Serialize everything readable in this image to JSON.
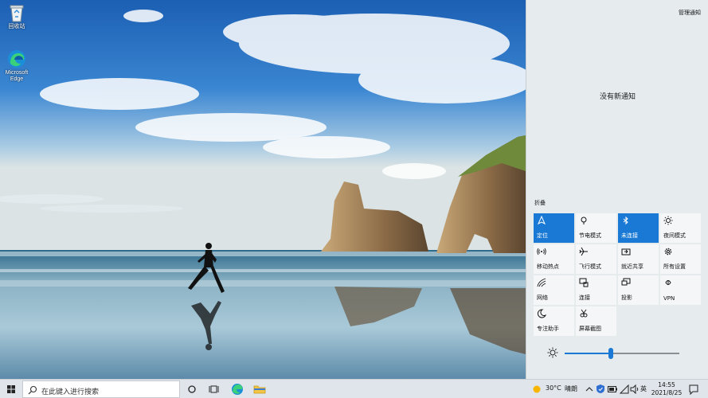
{
  "desktop": {
    "icons": [
      {
        "label": "回收站",
        "icon": "recycle-bin-icon"
      },
      {
        "label": "Microsoft Edge",
        "icon": "edge-icon"
      }
    ]
  },
  "action_center": {
    "manage_label": "管理通知",
    "empty_message": "没有新通知",
    "collapse_label": "折叠",
    "tiles": [
      {
        "label": "定位",
        "icon": "location-icon",
        "active": true
      },
      {
        "label": "节电模式",
        "icon": "battery-saver-icon",
        "active": false
      },
      {
        "label": "未连接",
        "icon": "bluetooth-icon",
        "active": true
      },
      {
        "label": "夜间模式",
        "icon": "night-light-icon",
        "active": false
      },
      {
        "label": "移动热点",
        "icon": "hotspot-icon",
        "active": false
      },
      {
        "label": "飞行模式",
        "icon": "airplane-icon",
        "active": false
      },
      {
        "label": "就近共享",
        "icon": "nearby-share-icon",
        "active": false
      },
      {
        "label": "所有设置",
        "icon": "settings-icon",
        "active": false
      },
      {
        "label": "网络",
        "icon": "network-icon",
        "active": false
      },
      {
        "label": "连接",
        "icon": "connect-icon",
        "active": false
      },
      {
        "label": "投影",
        "icon": "project-icon",
        "active": false
      },
      {
        "label": "VPN",
        "icon": "vpn-icon",
        "active": false
      },
      {
        "label": "专注助手",
        "icon": "focus-assist-icon",
        "active": false
      },
      {
        "label": "屏幕截图",
        "icon": "screen-snip-icon",
        "active": false
      }
    ],
    "brightness": {
      "icon": "brightness-icon",
      "level": 0.4
    }
  },
  "taskbar": {
    "search_placeholder": "在此键入进行搜索",
    "weather": {
      "temp": "30°C",
      "condition": "晴朗"
    },
    "ime": "英",
    "time": "14:55",
    "date": "2021/8/25"
  },
  "colors": {
    "accent": "#1a79d4",
    "panel_bg": "#e6ebee",
    "tile_bg": "#f4f6f7"
  }
}
